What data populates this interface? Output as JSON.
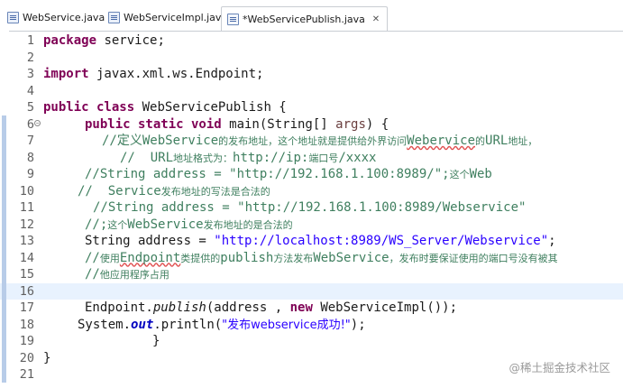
{
  "tabs": [
    {
      "label": "WebService.java",
      "icon": "java-file-icon",
      "active": false
    },
    {
      "label": "WebServiceImpl.java",
      "icon": "java-file-icon",
      "active": false
    },
    {
      "label": "*WebServicePublish.java",
      "icon": "java-file-icon",
      "active": true,
      "close": "✕"
    }
  ],
  "editor": {
    "current_line": 16,
    "lines": [
      {
        "n": "1"
      },
      {
        "n": "2"
      },
      {
        "n": "3"
      },
      {
        "n": "4"
      },
      {
        "n": "5"
      },
      {
        "n": "6"
      },
      {
        "n": "7"
      },
      {
        "n": "8"
      },
      {
        "n": "9"
      },
      {
        "n": "10"
      },
      {
        "n": "11"
      },
      {
        "n": "12"
      },
      {
        "n": "13"
      },
      {
        "n": "14"
      },
      {
        "n": "15"
      },
      {
        "n": "16"
      },
      {
        "n": "17"
      },
      {
        "n": "18"
      },
      {
        "n": "19"
      },
      {
        "n": "20"
      },
      {
        "n": "21"
      }
    ],
    "code": {
      "l1": {
        "kw": "package",
        "rest": " service;"
      },
      "l3": {
        "kw": "import",
        "rest": " javax.xml.ws.Endpoint;"
      },
      "l5": {
        "kw": "public class",
        "rest": " WebServicePublish {"
      },
      "l6": {
        "kw": "public static void",
        "p1": " main(String[] ",
        "arg": "args",
        "p2": ") {"
      },
      "l7": {
        "c1": "//定义",
        "c2": "WebService",
        "c3": "的发布地址，这个地址就是提供给外界访问",
        "c4": "Weberviсe",
        "c5": "的",
        "c6": "URL",
        "c7": "地址，"
      },
      "l8": {
        "c1": "//  URL",
        "c2": "地址格式为：",
        "c3": "http://ip:",
        "c4": "端口号",
        "c5": "/xxxx"
      },
      "l9": {
        "c1": "//String address = \"http://192.168.1.100:8989/\";",
        "c2": "这个",
        "c3": "Web"
      },
      "l10": {
        "c1": "//  Service",
        "c2": "发布地址的写法是合法的"
      },
      "l11": {
        "c1": "//String address = \"http://192.168.1.100:8989/Webservice\""
      },
      "l12": {
        "c1": "//;",
        "c2": "这个",
        "c3": "WebService",
        "c4": "发布地址的是合法的"
      },
      "l13": {
        "t1": "String address = ",
        "s1": "\"http://localhost:8989/WS_Server/Webservice\"",
        "t2": ";"
      },
      "l14": {
        "c1": "//",
        "c2": "使用",
        "c3": "Endpoint",
        "c4": "类提供的",
        "c5": "publish",
        "c6": "方法发布",
        "c7": "WebService",
        "c8": "，发布时要保证使用的端口号没有被其"
      },
      "l15": {
        "c1": "//",
        "c2": "他应用程序占用"
      },
      "l17": {
        "t1": "Endpoint.",
        "m1": "publish",
        "t2": "(address , ",
        "kw": "new",
        "t3": " WebServiceImpl());"
      },
      "l18": {
        "t1": "System.",
        "f1": "out",
        "t2": ".println(",
        "s1": "\"发布webservice成功!\"",
        "t3": ");"
      },
      "l19": {
        "t1": "}"
      },
      "l20": {
        "t1": "}"
      }
    }
  },
  "watermark": "@稀土掘金技术社区",
  "colors": {
    "keyword": "#7f0055",
    "string": "#2a00ff",
    "comment": "#3f7f5f",
    "field": "#0000c0",
    "current_line": "#e8f2fe"
  }
}
